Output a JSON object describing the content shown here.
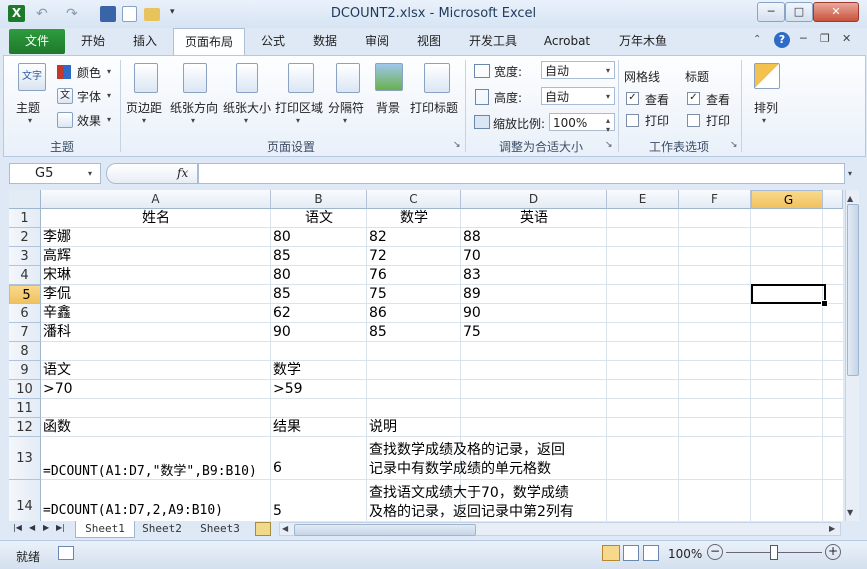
{
  "window": {
    "title": "DCOUNT2.xlsx - Microsoft Excel",
    "app_icon": "X",
    "btn_min": "─",
    "btn_max": "□",
    "btn_close": "✕"
  },
  "tabs": [
    "文件",
    "开始",
    "插入",
    "页面布局",
    "公式",
    "数据",
    "审阅",
    "视图",
    "开发工具",
    "Acrobat",
    "万年木鱼"
  ],
  "ribbon": {
    "theme_group": {
      "label": "主题",
      "themes_btn": "主题",
      "colors": "颜色",
      "fonts": "字体",
      "effects": "效果"
    },
    "page_setup": {
      "label": "页面设置",
      "margins": "页边距",
      "orientation": "纸张方向",
      "size": "纸张大小",
      "print_area": "打印区域",
      "breaks": "分隔符",
      "background": "背景",
      "print_titles": "打印标题"
    },
    "scale_to_fit": {
      "label": "调整为合适大小",
      "width_label": "宽度:",
      "width_value": "自动",
      "height_label": "高度:",
      "height_value": "自动",
      "scale_label": "缩放比例:",
      "scale_value": "100%"
    },
    "sheet_options": {
      "label": "工作表选项",
      "gridlines": "网格线",
      "headings": "标题",
      "view": "查看",
      "print": "打印",
      "view2": "查看",
      "print2": "打印"
    },
    "arrange": {
      "label": "排列"
    }
  },
  "formula_bar": {
    "name_box": "G5",
    "fx": "fx",
    "formula": ""
  },
  "columns": [
    "A",
    "B",
    "C",
    "D",
    "E",
    "F",
    "G"
  ],
  "rows": [
    "1",
    "2",
    "3",
    "4",
    "5",
    "6",
    "7",
    "8",
    "9",
    "10",
    "11",
    "12",
    "13",
    "14"
  ],
  "selected_cell": "G5",
  "cells": {
    "A1": "姓名",
    "B1": "语文",
    "C1": "数学",
    "D1": "英语",
    "A2": "李娜",
    "B2": "80",
    "C2": "82",
    "D2": "88",
    "A3": "高辉",
    "B3": "85",
    "C3": "72",
    "D3": "70",
    "A4": "宋琳",
    "B4": "80",
    "C4": "76",
    "D4": "83",
    "A5": "李侃",
    "B5": "85",
    "C5": "75",
    "D5": "89",
    "A6": "辛鑫",
    "B6": "62",
    "C6": "86",
    "D6": "90",
    "A7": "潘科",
    "B7": "90",
    "C7": "85",
    "D7": "75",
    "A9": "语文",
    "B9": "数学",
    "A10": ">70",
    "B10": ">59",
    "A12": "函数",
    "B12": "结果",
    "C12": "说明",
    "A13": "=DCOUNT(A1:D7,\"数学\",B9:B10)",
    "B13": "6",
    "C13_line1": "查找数学成绩及格的记录，返回",
    "C13_line2": "记录中有数学成绩的单元格数",
    "A14": "=DCOUNT(A1:D7,2,A9:B10)",
    "B14": "5",
    "C14_line1": "查找语文成绩大于70，数学成绩",
    "C14_line2": "及格的记录，返回记录中第2列有"
  },
  "sheets": [
    "Sheet1",
    "Sheet2",
    "Sheet3"
  ],
  "status": {
    "ready": "就绪",
    "zoom": "100%"
  }
}
